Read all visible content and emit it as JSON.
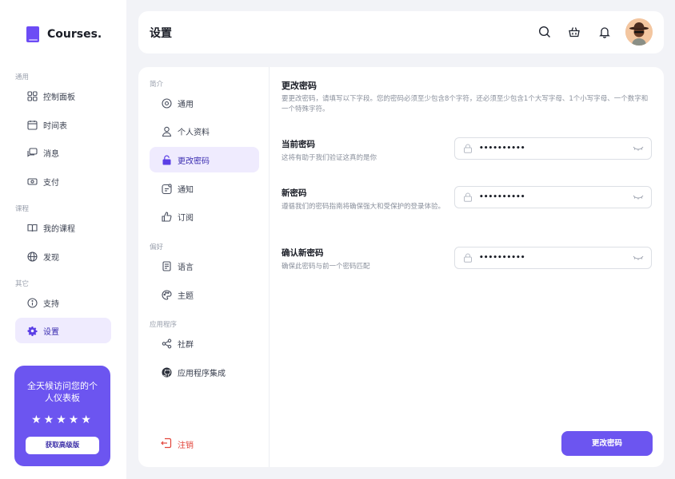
{
  "app": {
    "name": "Courses."
  },
  "sidebar": {
    "sections": [
      "通用",
      "课程",
      "其它"
    ],
    "items": [
      {
        "label": "控制面板",
        "icon": "dashboard-icon"
      },
      {
        "label": "时间表",
        "icon": "calendar-icon"
      },
      {
        "label": "消息",
        "icon": "message-icon"
      },
      {
        "label": "支付",
        "icon": "payment-icon"
      },
      {
        "label": "我的课程",
        "icon": "book-open-icon"
      },
      {
        "label": "发现",
        "icon": "globe-icon"
      },
      {
        "label": "支持",
        "icon": "info-icon"
      },
      {
        "label": "设置",
        "icon": "gear-icon",
        "active": true
      }
    ],
    "promo": {
      "text": "全天候访问您的个人仪表板",
      "stars": "★★★★★",
      "button": "获取高级版"
    }
  },
  "header": {
    "title": "设置"
  },
  "subnav": {
    "sections": [
      "简介",
      "偏好",
      "应用程序"
    ],
    "items": [
      {
        "label": "通用",
        "icon": "circle-icon"
      },
      {
        "label": "个人资料",
        "icon": "user-icon"
      },
      {
        "label": "更改密码",
        "icon": "lock-icon",
        "active": true
      },
      {
        "label": "通知",
        "icon": "notification-icon"
      },
      {
        "label": "订阅",
        "icon": "thumbs-up-icon"
      },
      {
        "label": "语言",
        "icon": "document-icon"
      },
      {
        "label": "主题",
        "icon": "palette-icon"
      },
      {
        "label": "社群",
        "icon": "share-icon"
      },
      {
        "label": "应用程序集成",
        "icon": "github-icon"
      }
    ],
    "logout": "注销"
  },
  "content": {
    "title": "更改密码",
    "description": "要更改密码，请填写以下字段。您的密码必须至少包含8个字符，还必须至少包含1个大写字母、1个小写字母、一个数字和一个特殊字符。",
    "fields": [
      {
        "label": "当前密码",
        "hint": "这将有助于我们验证这真的是你",
        "value": "••••••••••"
      },
      {
        "label": "新密码",
        "hint": "遵循我们的密码指南将确保强大和受保护的登录体验。",
        "value": "••••••••••"
      },
      {
        "label": "确认新密码",
        "hint": "确保此密码与前一个密码匹配",
        "value": "••••••••••"
      }
    ],
    "submit": "更改密码"
  },
  "colors": {
    "accent": "#6c55f0",
    "danger": "#e2453b"
  }
}
